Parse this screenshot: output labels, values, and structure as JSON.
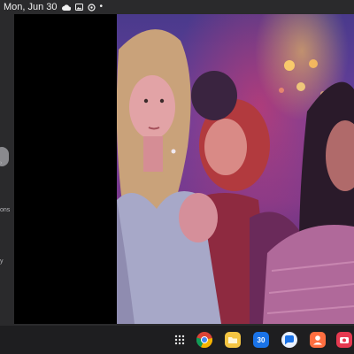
{
  "status_bar": {
    "date": "Mon, Jun 30",
    "icons": [
      "cloud-icon",
      "image-icon",
      "sync-icon"
    ],
    "dot": "•"
  },
  "side_panel": {
    "partial_texts": [
      "ons",
      "y"
    ]
  },
  "video": {
    "scene": "nightclub-scene"
  },
  "taskbar": {
    "apps": [
      {
        "name": "app-drawer",
        "icon": "grid-icon"
      },
      {
        "name": "chrome",
        "icon": "chrome-icon",
        "color": "#ea4335"
      },
      {
        "name": "files",
        "icon": "folder-icon",
        "color": "#f5c542"
      },
      {
        "name": "calendar",
        "icon": "calendar-icon",
        "label": "30",
        "color": "#1a73e8"
      },
      {
        "name": "messages",
        "icon": "message-icon",
        "color": "#1a73e8"
      },
      {
        "name": "contacts",
        "icon": "contact-icon",
        "color": "#ff6e40"
      },
      {
        "name": "camera",
        "icon": "camera-icon",
        "color": "#e53950"
      }
    ]
  }
}
